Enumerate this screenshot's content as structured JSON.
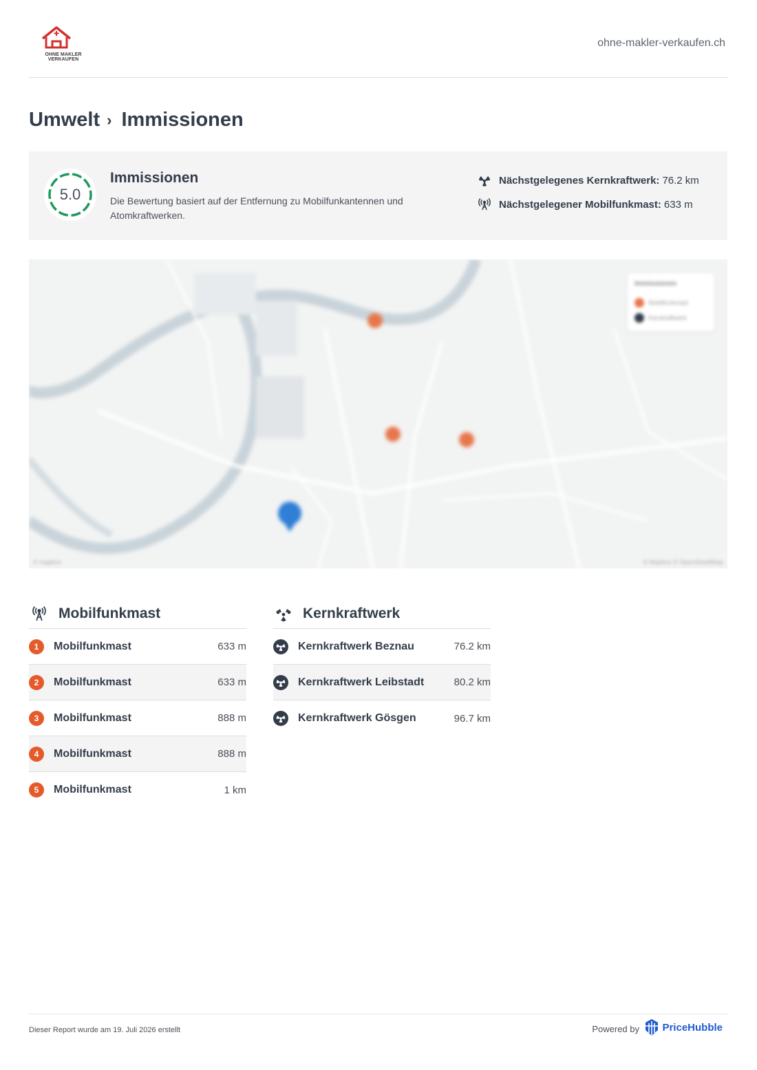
{
  "header": {
    "logo_text_line1": "OHNE MAKLER",
    "logo_text_line2": "VERKAUFEN",
    "site_url": "ohne-makler-verkaufen.ch"
  },
  "breadcrumb": {
    "parent": "Umwelt",
    "separator": "›",
    "current": "Immissionen"
  },
  "score_card": {
    "score": "5.0",
    "score_fraction": 1.0,
    "title": "Immissionen",
    "description": "Die Bewertung basiert auf der Entfernung zu Mobilfunkantennen und Atomkraftwerken.",
    "stats": [
      {
        "icon": "radiation-icon",
        "label": "Nächstgelegenes Kernkraftwerk:",
        "value": "76.2 km"
      },
      {
        "icon": "antenna-icon",
        "label": "Nächstgelegener Mobilfunkmast:",
        "value": "633 m"
      }
    ]
  },
  "map": {
    "legend_title": "Immissionen",
    "legend_items": [
      "Mobilfunkmast",
      "Kernkraftwerk"
    ],
    "attribution_left": "© mapbox",
    "attribution_right": "© Mapbox © OpenStreetMap"
  },
  "mobilfunk": {
    "title": "Mobilfunkmast",
    "icon": "antenna-icon",
    "rows": [
      {
        "num": "1",
        "name": "Mobilfunkmast",
        "value": "633 m"
      },
      {
        "num": "2",
        "name": "Mobilfunkmast",
        "value": "633 m"
      },
      {
        "num": "3",
        "name": "Mobilfunkmast",
        "value": "888 m"
      },
      {
        "num": "4",
        "name": "Mobilfunkmast",
        "value": "888 m"
      },
      {
        "num": "5",
        "name": "Mobilfunkmast",
        "value": "1 km"
      }
    ]
  },
  "kernkraft": {
    "title": "Kernkraftwerk",
    "icon": "radiation-icon",
    "rows": [
      {
        "name": "Kernkraftwerk Beznau",
        "value": "76.2 km"
      },
      {
        "name": "Kernkraftwerk Leibstadt",
        "value": "80.2 km"
      },
      {
        "name": "Kernkraftwerk Gösgen",
        "value": "96.7 km"
      }
    ]
  },
  "footer": {
    "note": "Dieser Report wurde am 19. Juli 2026 erstellt",
    "powered_by": "Powered by",
    "brand": "PriceHubble"
  },
  "colors": {
    "accent_orange": "#e55a2b",
    "score_green": "#1f9a5b",
    "pin_blue": "#2f7fd6",
    "brand_blue": "#1f5bd1"
  }
}
